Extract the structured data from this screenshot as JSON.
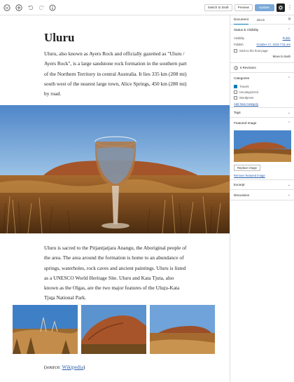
{
  "toolbar": {
    "switch_to_draft": "Switch to Draft",
    "preview": "Preview",
    "update": "Update"
  },
  "post": {
    "title": "Uluru",
    "paragraph1": "Uluru, also known as Ayers Rock and officially gazetted as \"Uluru / Ayers Rock\", is a large sandstone rock formation in the southern part of the Northern Territory in central Australia. It lies 335 km (208 mi) south west of the nearest large town, Alice Springs, 450 km (280 mi) by road.",
    "paragraph2": "Uluru is sacred to the Pitjantjatjara Anangu, the Aboriginal people of the area. The area around the formation is home to an abundance of springs, waterholes, rock caves and ancient paintings. Uluru is listed as a UNESCO World Heritage Site. Uluru and Kata Tjuta, also known as the Olgas, are the two major features of the Uluṟu-Kata Tjuṯa National Park.",
    "source_prefix": "(source: ",
    "source_link": "Wikipedia",
    "source_suffix": ")"
  },
  "sidebar": {
    "tabs": [
      "Document",
      "Block"
    ],
    "status_panel": {
      "title": "Status & Visibility",
      "visibility_label": "Visibility",
      "visibility_value": "Public",
      "publish_label": "Publish",
      "publish_value": "October 17, 2018 7:51 am",
      "stick_label": "Stick to the front page",
      "move_to_trash": "Move to trash"
    },
    "revisions": "6 Revisions",
    "categories_panel": {
      "title": "Categories",
      "items": [
        {
          "label": "Travels",
          "checked": true
        },
        {
          "label": "Uncategorized",
          "checked": false
        },
        {
          "label": "Wordpress",
          "checked": false
        }
      ],
      "add_new": "Add New Category"
    },
    "tags_panel": {
      "title": "Tags"
    },
    "featured_panel": {
      "title": "Featured Image",
      "replace": "Replace image",
      "remove": "Remove featured image"
    },
    "excerpt_panel": {
      "title": "Excerpt"
    },
    "discussion_panel": {
      "title": "Discussion"
    }
  },
  "colors": {
    "accent": "#007cba",
    "update_button": "#7aa8d8",
    "link": "#2b5fad"
  },
  "icons": [
    "wordpress-icon",
    "add-icon",
    "undo-icon",
    "redo-icon",
    "info-icon",
    "gear-icon",
    "more-icon",
    "close-icon",
    "chevron-up-icon",
    "chevron-down-icon",
    "revisions-icon"
  ]
}
